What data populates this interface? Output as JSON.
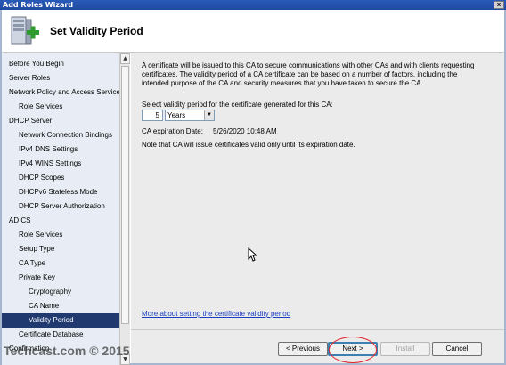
{
  "window": {
    "title": "Add Roles Wizard",
    "close_glyph": "x"
  },
  "header": {
    "title": "Set Validity Period",
    "icon": "server-add-icon"
  },
  "nav": {
    "items": [
      {
        "label": "Before You Begin",
        "level": 0,
        "selected": false
      },
      {
        "label": "Server Roles",
        "level": 0,
        "selected": false
      },
      {
        "label": "Network Policy and Access Services",
        "level": 0,
        "selected": false
      },
      {
        "label": "Role Services",
        "level": 1,
        "selected": false
      },
      {
        "label": "DHCP Server",
        "level": 0,
        "selected": false
      },
      {
        "label": "Network Connection Bindings",
        "level": 1,
        "selected": false
      },
      {
        "label": "IPv4 DNS Settings",
        "level": 1,
        "selected": false
      },
      {
        "label": "IPv4 WINS Settings",
        "level": 1,
        "selected": false
      },
      {
        "label": "DHCP Scopes",
        "level": 1,
        "selected": false
      },
      {
        "label": "DHCPv6 Stateless Mode",
        "level": 1,
        "selected": false
      },
      {
        "label": "DHCP Server Authorization",
        "level": 1,
        "selected": false
      },
      {
        "label": "AD CS",
        "level": 0,
        "selected": false
      },
      {
        "label": "Role Services",
        "level": 1,
        "selected": false
      },
      {
        "label": "Setup Type",
        "level": 1,
        "selected": false
      },
      {
        "label": "CA Type",
        "level": 1,
        "selected": false
      },
      {
        "label": "Private Key",
        "level": 1,
        "selected": false
      },
      {
        "label": "Cryptography",
        "level": 2,
        "selected": false
      },
      {
        "label": "CA Name",
        "level": 2,
        "selected": false
      },
      {
        "label": "Validity Period",
        "level": 2,
        "selected": true
      },
      {
        "label": "Certificate Database",
        "level": 1,
        "selected": false
      },
      {
        "label": "Confirmation",
        "level": 0,
        "selected": false
      }
    ]
  },
  "content": {
    "intro": "A certificate will be issued to this CA to secure communications with other CAs and with clients requesting certificates. The validity period of a CA certificate can be based on a number of factors, including the intended purpose of the CA and security measures that you have taken to secure the CA.",
    "select_label": "Select validity period for the certificate generated for this CA:",
    "period_value": "5",
    "period_unit": "Years",
    "expiration_label": "CA expiration Date:",
    "expiration_value": "5/26/2020 10:48 AM",
    "note": "Note that CA will issue certificates valid only until its expiration date.",
    "link": "More about setting the certificate validity period"
  },
  "buttons": {
    "previous": "< Previous",
    "next": "Next >",
    "install": "Install",
    "cancel": "Cancel"
  },
  "watermark": "Techcast.com © 2015",
  "colors": {
    "selected_bg": "#203a70",
    "link": "#1a3fc0",
    "highlight_circle": "#e02828"
  }
}
